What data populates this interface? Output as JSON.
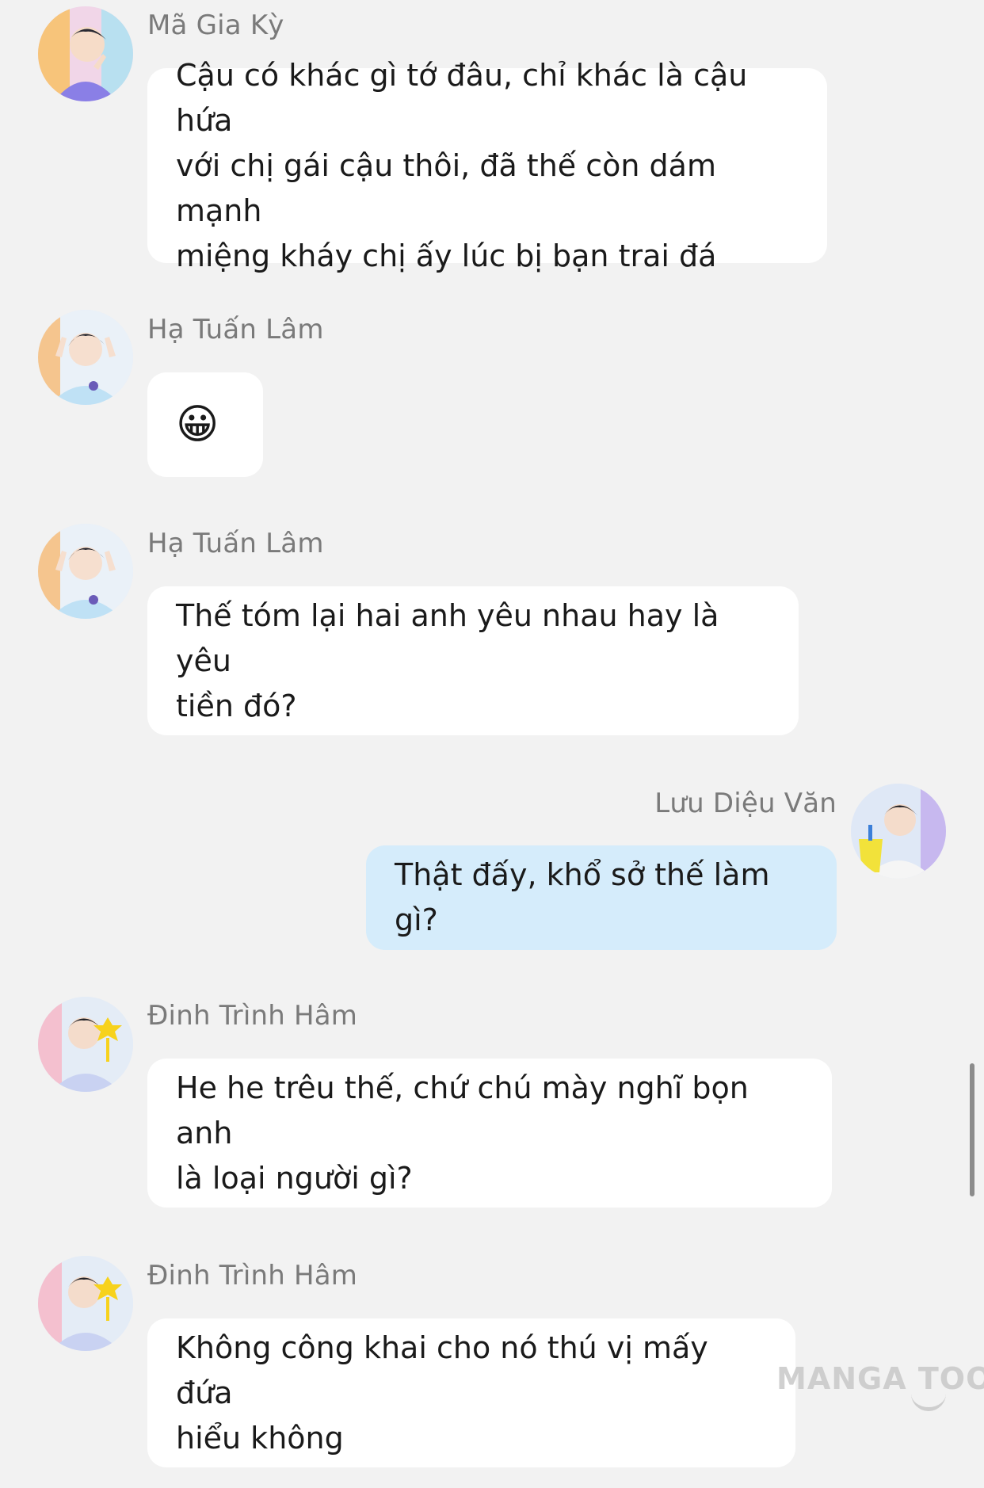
{
  "messages": [
    {
      "sender": "Mã Gia Kỳ",
      "text": "Cậu có khác gì tớ đâu, chỉ khác là cậu hứa\nvới chị gái cậu thôi, đã thế còn dám mạnh\nmiệng kháy chị ấy lúc bị bạn trai đá",
      "side": "left"
    },
    {
      "sender": "Hạ Tuấn Lâm",
      "text": "😀",
      "side": "left"
    },
    {
      "sender": "Hạ Tuấn Lâm",
      "text": "Thế tóm lại hai anh yêu nhau hay là yêu\ntiền đó?",
      "side": "left"
    },
    {
      "sender": "Lưu Diệu Văn",
      "text": "Thật đấy, khổ sở thế làm gì?",
      "side": "right"
    },
    {
      "sender": "Đinh Trình Hâm",
      "text": "He he trêu thế, chứ chú mày nghĩ bọn anh\nlà loại người gì?",
      "side": "left"
    },
    {
      "sender": "Đinh Trình Hâm",
      "text": "Không công khai cho nó thú vị mấy đứa\nhiểu không",
      "side": "left"
    }
  ],
  "watermark": "MANGA TOON",
  "colors": {
    "background": "#f2f2f2",
    "bubble_other": "#ffffff",
    "bubble_mine": "#d5ecfb",
    "sender_name": "#7a7a7a",
    "message_text": "#1a1a1a"
  }
}
